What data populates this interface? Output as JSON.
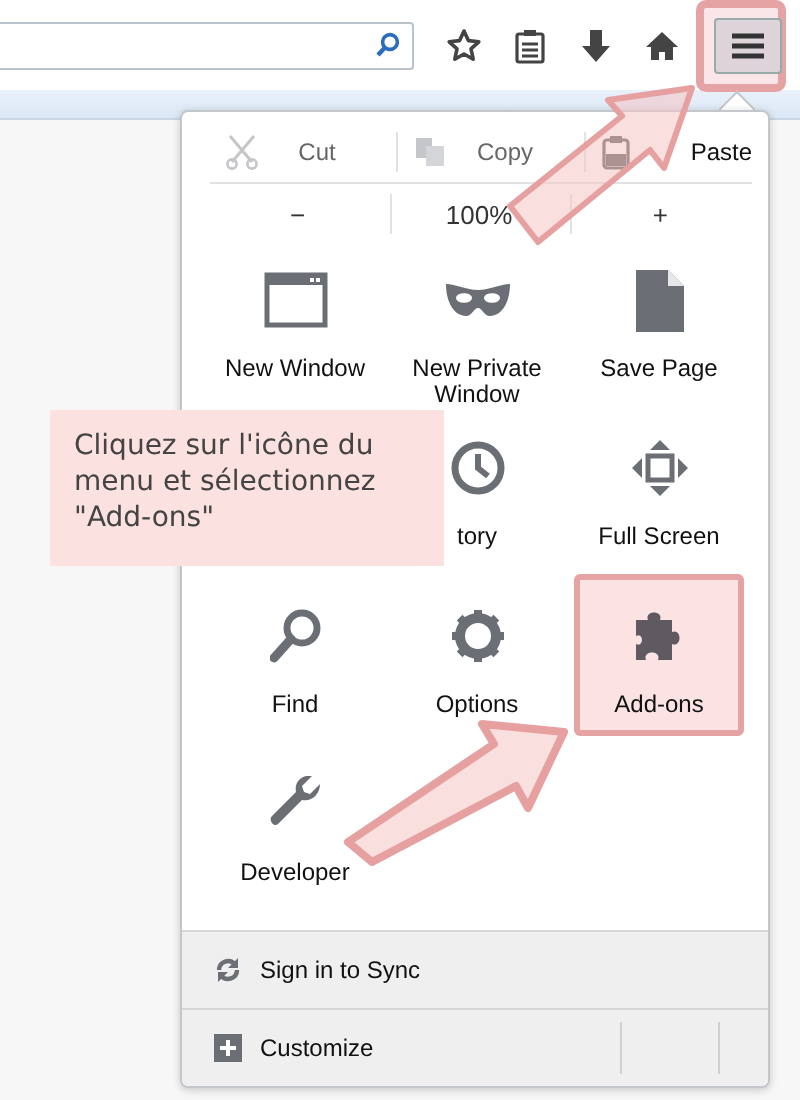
{
  "toolbar": {
    "buttons": [
      {
        "kind": "star",
        "highlighted": false
      },
      {
        "kind": "reader",
        "highlighted": false
      },
      {
        "kind": "download",
        "highlighted": false
      },
      {
        "kind": "home",
        "highlighted": false
      },
      {
        "kind": "menu",
        "highlighted": true
      }
    ]
  },
  "menu": {
    "edit": [
      {
        "kind": "cut",
        "label": "Cut",
        "disabled": true
      },
      {
        "kind": "copy",
        "label": "Copy",
        "disabled": true
      },
      {
        "kind": "paste",
        "label": "Paste",
        "disabled": false
      }
    ],
    "zoom": [
      "−",
      "100%",
      "+"
    ],
    "grid": [
      {
        "kind": "window",
        "label": "New Window",
        "highlighted": false
      },
      {
        "kind": "mask",
        "label": "New Private Window",
        "highlighted": false
      },
      {
        "kind": "page",
        "label": "Save Page",
        "highlighted": false
      },
      {
        "kind": "hidden"
      },
      {
        "kind": "clock",
        "label": "tory",
        "highlighted": false
      },
      {
        "kind": "fullscreen",
        "label": "Full Screen",
        "highlighted": false
      },
      {
        "kind": "find",
        "label": "Find",
        "highlighted": false
      },
      {
        "kind": "gear",
        "label": "Options",
        "highlighted": false
      },
      {
        "kind": "puzzle",
        "label": "Add-ons",
        "highlighted": true
      },
      {
        "kind": "wrench",
        "label": "Developer",
        "highlighted": false
      }
    ],
    "footer": [
      {
        "kind": "sync",
        "label": "Sign in to Sync"
      },
      {
        "kind": "customize",
        "label": "Customize"
      }
    ]
  },
  "callout": {
    "text": "Cliquez sur l'icône du menu et sélectionnez \"Add-ons\""
  }
}
